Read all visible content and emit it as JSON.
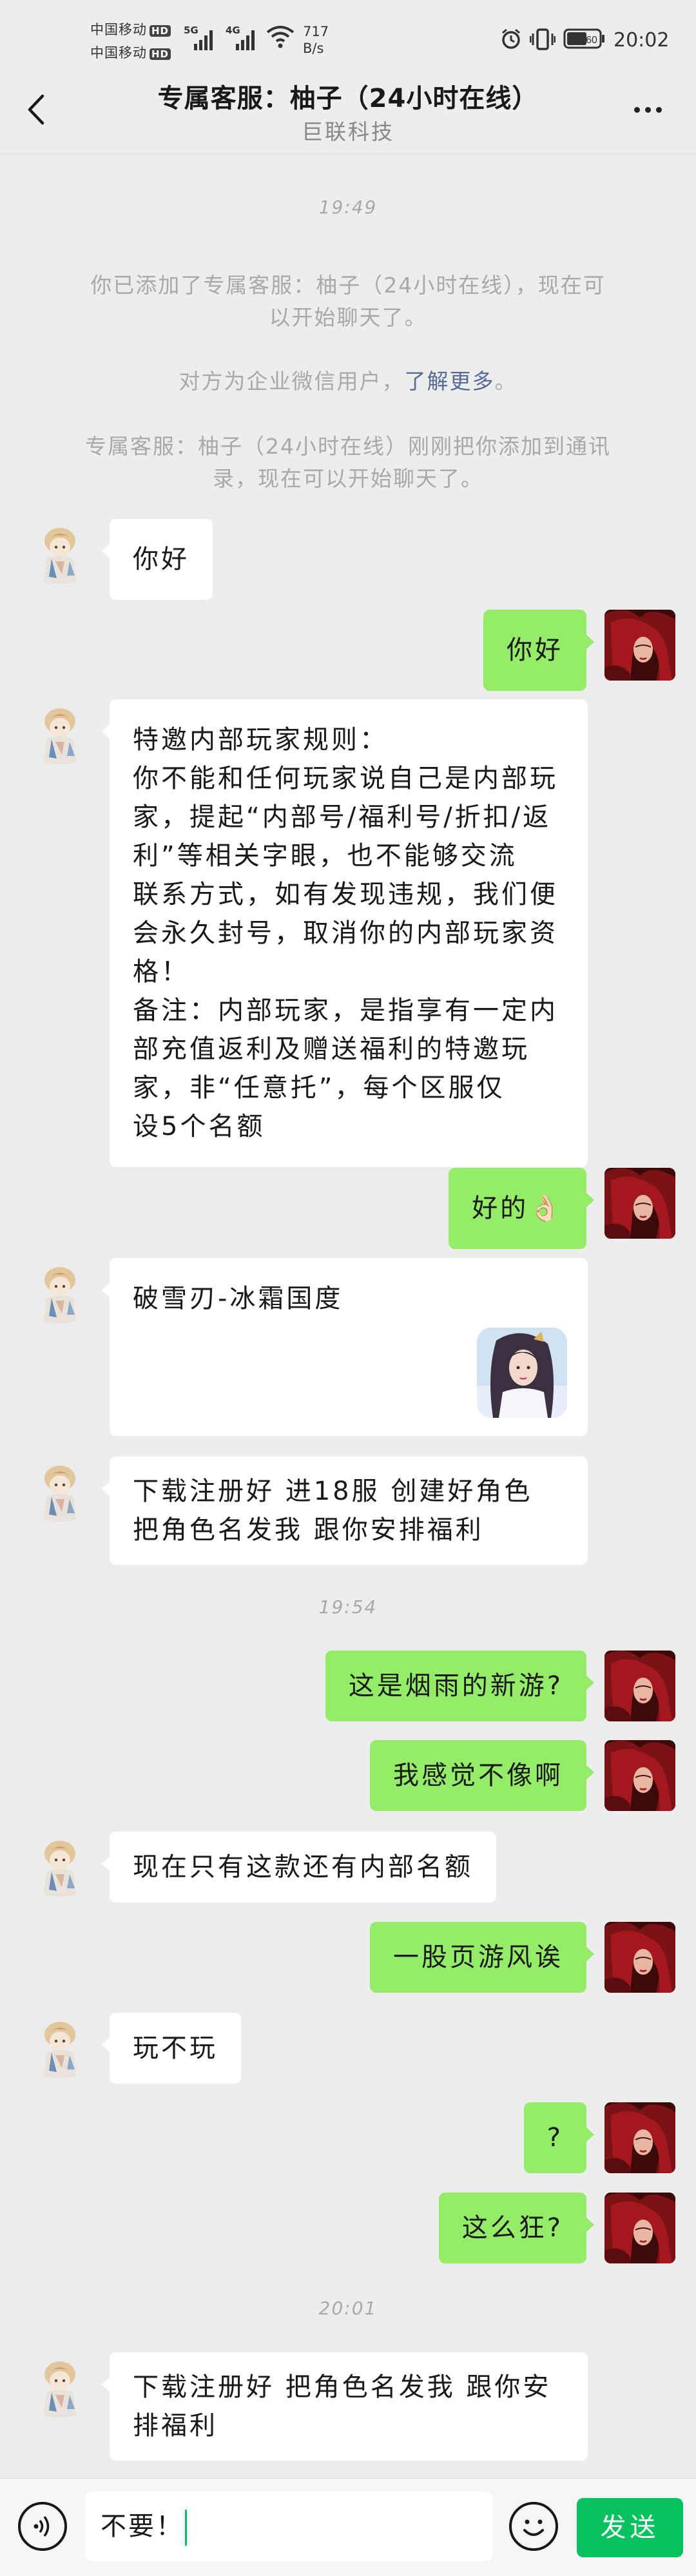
{
  "status_bar": {
    "carrier_1": "中国移动",
    "carrier_2": "中国移动",
    "hd_badge": "HD",
    "sig1_label": "5G",
    "sig2_label": "4G",
    "net_speed_value": "717",
    "net_speed_unit": "B/s",
    "battery_level": "60",
    "time": "20:02"
  },
  "header": {
    "title": "专属客服：柚子（24小时在线）",
    "subtitle": "巨联科技"
  },
  "messages": {
    "ts_1": "19:49",
    "sys_1a": "你已添加了专属客服：柚子（24小时在线），现在可",
    "sys_1b": "以开始聊天了。",
    "sys_2_text": "对方为企业微信用户，",
    "sys_2_link": "了解更多",
    "sys_2_end": "。",
    "sys_3a": "专属客服：柚子（24小时在线）刚刚把你添加到通讯",
    "sys_3b": "录，现在可以开始聊天了。",
    "m1": "你好",
    "m2": "你好",
    "m3_lines": [
      "特邀内部玩家规则：",
      "你不能和任何玩家说自己是内部玩",
      "家，提起“内部号/福利号/折扣/返",
      "利”等相关字眼，也不能够交流",
      "联系方式，如有发现违规，我们便",
      "会永久封号，取消你的内部玩家资",
      "格！",
      "备注：内部玩家，是指享有一定内",
      "部充值返利及赠送福利的特邀玩",
      "家，非“任意托”，每个区服仅",
      "设5个名额"
    ],
    "m4": "好的👌🏻",
    "m5_card_title": "破雪刃-冰霜国度",
    "m6_lines": [
      "下载注册好 进18服  创建好角色",
      "把角色名发我 跟你安排福利"
    ],
    "ts_2": "19:54",
    "m7": "这是烟雨的新游?",
    "m8": "我感觉不像啊",
    "m9": "现在只有这款还有内部名额",
    "m10": "一股页游风诶",
    "m11": "玩不玩",
    "m12": "?",
    "m13": "这么狂?",
    "ts_3": "20:01",
    "m14_lines": [
      "下载注册好 把角色名发我 跟你安",
      "排福利"
    ]
  },
  "input_bar": {
    "draft_text": "不要！",
    "send_label": "发送",
    "voice_icon": "voice-icon",
    "emoji_icon": "emoji-icon"
  },
  "colors": {
    "background": "#ededed",
    "my_bubble": "#95ec69",
    "their_bubble": "#ffffff",
    "send_button": "#07c160",
    "link": "#576b95"
  }
}
